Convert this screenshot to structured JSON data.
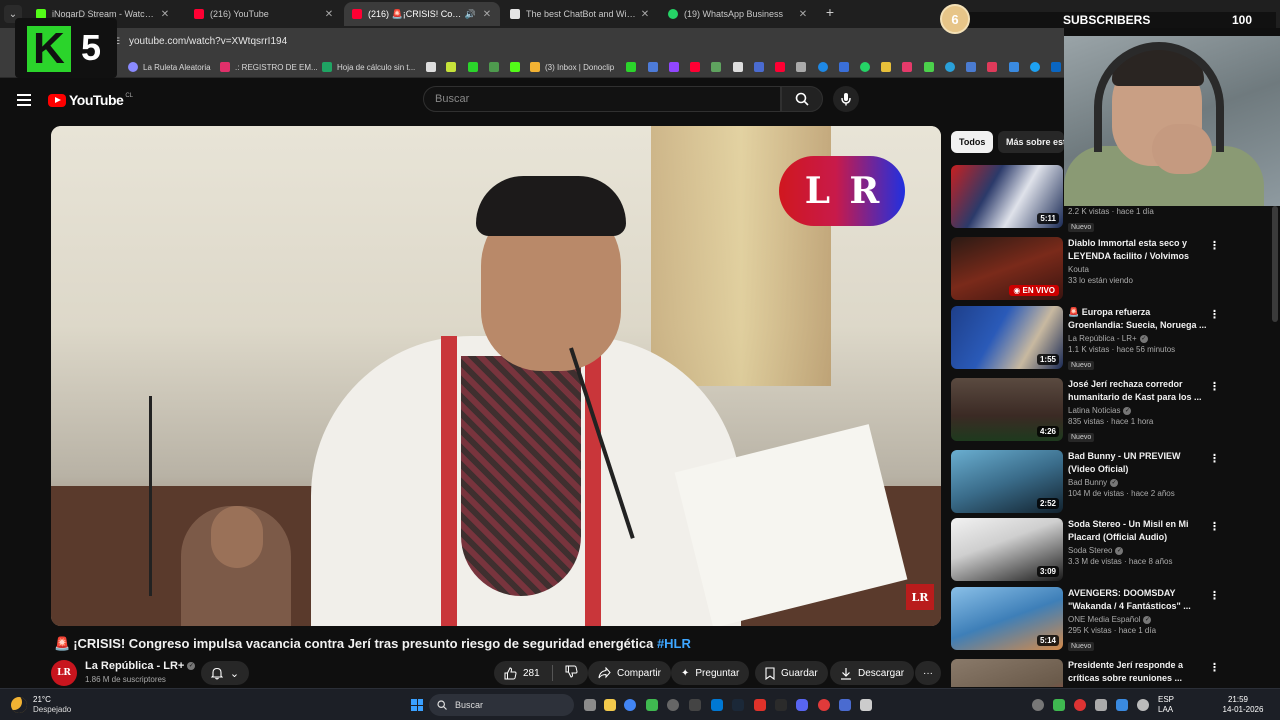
{
  "browser": {
    "tabs": [
      {
        "title": "iNogarD Stream - Watch Live o",
        "favicon_color": "#53fc18",
        "active": false
      },
      {
        "title": "(216) YouTube",
        "favicon_color": "#ff0033",
        "active": false
      },
      {
        "title": "(216) 🚨¡CRISIS! Congreso",
        "favicon_color": "#ff0033",
        "active": true
      },
      {
        "title": "The best ChatBot and Widgets",
        "favicon_color": "#e5e5e5",
        "active": false
      },
      {
        "title": "(19) WhatsApp Business",
        "favicon_color": "#25d366",
        "active": false
      }
    ],
    "new_tab": "+",
    "url": "youtube.com/watch?v=XWtqsrrI194",
    "bookmarks": [
      {
        "label": "La Ruleta Aleatoria",
        "color": "#8a8aff"
      },
      {
        "label": ".: REGISTRO DE EM...",
        "color": "#e0306a"
      },
      {
        "label": "Hoja de cálculo sin t...",
        "color": "#1fa463"
      },
      {
        "label": "(3) Inbox | Donoclip",
        "color": "#f2b233"
      }
    ]
  },
  "stream_overlay": {
    "logo_letter": "K",
    "logo_number": "5",
    "sub_count_badge": "6",
    "sub_label": "SUBSCRIBERS",
    "sub_goal": "100"
  },
  "youtube": {
    "logo_text": "YouTube",
    "region": "CL",
    "search_placeholder": "Buscar",
    "video": {
      "watermark_l": "L",
      "watermark_r": "R",
      "corner_logo": "LR",
      "title_emoji": "🚨",
      "title": "¡CRISIS! Congreso impulsa vacancia contra Jerí tras presunto riesgo de seguridad energética",
      "hashtag": "#HLR",
      "channel_avatar": "LR",
      "channel_name": "La República - LR+",
      "subscribers": "1.86 M de suscriptores",
      "likes": "281",
      "share": "Compartir",
      "ask": "Preguntar",
      "save": "Guardar",
      "download": "Descargar",
      "more": "···"
    },
    "chips": [
      "Todos",
      "Más sobre este canal"
    ],
    "recommendations": [
      {
        "title": "",
        "channel": "",
        "views": "2.2 K vistas · hace 1 día",
        "badge": "Nuevo",
        "duration": "5:11",
        "thumb": "#2b3a6a"
      },
      {
        "title": "Diablo Immortal esta seco y LEYENDA facilito / Volvimos",
        "channel": "Kouta",
        "views": "33 lo están viendo",
        "badge": "",
        "duration": "EN VIVO",
        "live": true,
        "thumb": "#5b1a14"
      },
      {
        "title": "🚨 Europa refuerza Groenlandia: Suecia, Noruega ...",
        "channel": "La República - LR+",
        "views": "1.1 K vistas · hace 56 minutos",
        "badge": "Nuevo",
        "duration": "1:55",
        "thumb": "#1e3f8a"
      },
      {
        "title": "José Jerí rechaza corredor humanitario de Kast para los ...",
        "channel": "Latina Noticias",
        "views": "835 vistas · hace 1 hora",
        "badge": "Nuevo",
        "duration": "4:26",
        "thumb": "#3b2a24"
      },
      {
        "title": "Bad Bunny - UN PREVIEW (Video Oficial)",
        "channel": "Bad Bunny",
        "views": "104 M de vistas · hace 2 años",
        "badge": "",
        "duration": "2:52",
        "thumb": "#3a6c8a"
      },
      {
        "title": "Soda Stereo - Un Misil en Mi Placard (Official Audio)",
        "channel": "Soda Stereo",
        "views": "3.3 M de vistas · hace 8 años",
        "badge": "",
        "duration": "3:09",
        "thumb": "#d9d9d9"
      },
      {
        "title": "AVENGERS: DOOMSDAY \"Wakanda / 4 Fantásticos\" ...",
        "channel": "ONE Media Español",
        "views": "295 K vistas · hace 1 día",
        "badge": "Nuevo",
        "duration": "5:14",
        "thumb": "#3e7fb8"
      },
      {
        "title": "Presidente Jerí responde a críticas sobre reuniones ...",
        "channel": "",
        "views": "",
        "badge": "",
        "duration": "",
        "thumb": "#6a5a4a"
      }
    ]
  },
  "taskbar": {
    "weather_temp": "21°C",
    "weather_desc": "Despejado",
    "search_label": "Buscar",
    "lang": "ESP",
    "lang2": "LAA",
    "time": "21:59",
    "date": "14-01-2026"
  }
}
